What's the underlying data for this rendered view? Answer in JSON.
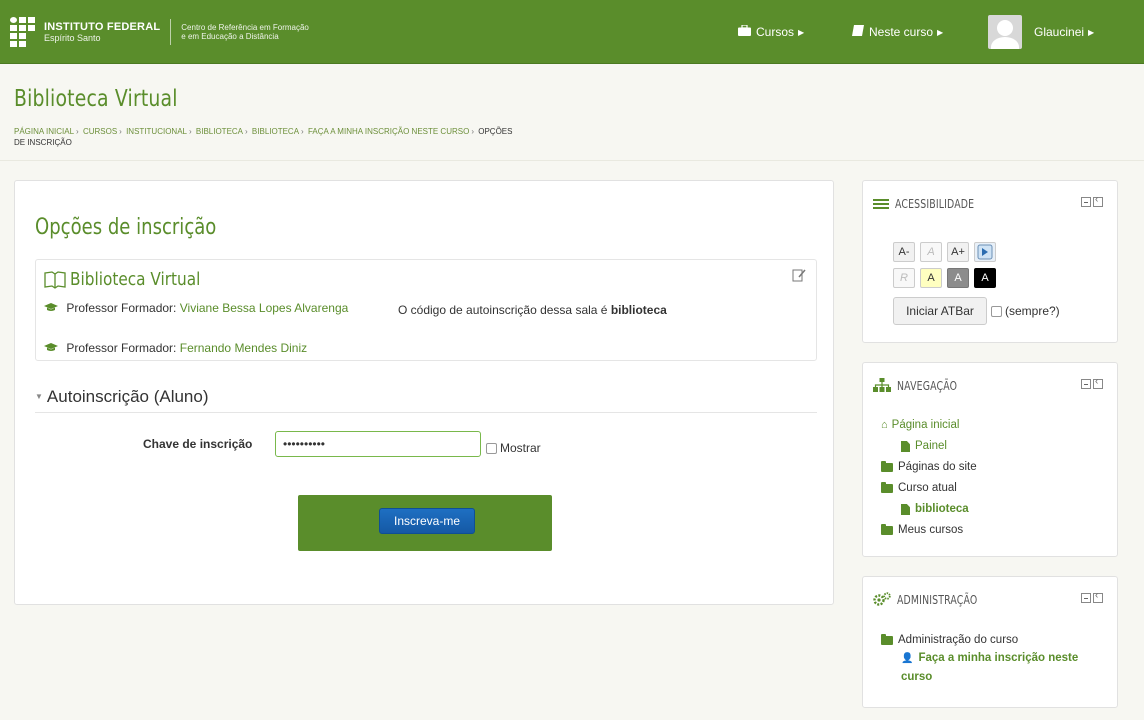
{
  "colors": {
    "brand": "#5a8d2b",
    "button_primary": "#1e6fc2"
  },
  "navbar": {
    "logo_title": "INSTITUTO FEDERAL",
    "logo_subtitle": "Espírito Santo",
    "logo_desc_1": "Centro de Referência em Formação",
    "logo_desc_2": "e em Educação a Distância",
    "menu_courses": "Cursos",
    "menu_this_course": "Neste curso",
    "user_name": "Glaucinei"
  },
  "header": {
    "site_title": "Biblioteca Virtual",
    "breadcrumb": [
      "PÁGINA INICIAL",
      "CURSOS",
      "INSTITUCIONAL",
      "BIBLIOTECA",
      "BIBLIOTECA",
      "FAÇA A MINHA INSCRIÇÃO NESTE CURSO",
      "OPÇÕES DE INSCRIÇÃO"
    ]
  },
  "main": {
    "title": "Opções de inscrição",
    "course": {
      "name": "Biblioteca Virtual",
      "teacher_role": "Professor Formador:",
      "teacher1_name": "Viviane Bessa Lopes Alvarenga",
      "teacher2_name": "Fernando Mendes Diniz",
      "selfcode_text": "O código de autoinscrição dessa sala é",
      "selfcode_value": "biblioteca"
    },
    "section_title": "Autoinscrição (Aluno)",
    "key_label": "Chave de inscrição",
    "key_value": "••••••••••",
    "show_label": "Mostrar",
    "submit_label": "Inscreva-me"
  },
  "blocks": {
    "accessibility": {
      "title": "ACESSIBILIDADE",
      "buttons_row1": [
        "A-",
        "A",
        "A+"
      ],
      "buttons_row2": [
        "R",
        "A",
        "A",
        "A"
      ],
      "atbar_label": "Iniciar ATBar",
      "always_label": "(sempre?)"
    },
    "navigation": {
      "title": "NAVEGAÇÃO",
      "home": "Página inicial",
      "dashboard": "Painel",
      "site_pages": "Páginas do site",
      "current_course": "Curso atual",
      "course_short": "biblioteca",
      "my_courses": "Meus cursos"
    },
    "admin": {
      "title": "ADMINISTRAÇÃO",
      "course_admin": "Administração do curso",
      "enrol_me": "Faça a minha inscrição neste curso"
    }
  }
}
